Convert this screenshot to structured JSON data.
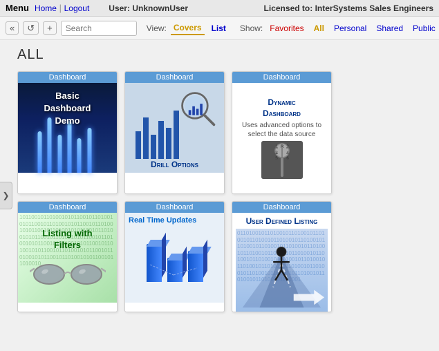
{
  "menubar": {
    "menu_label": "Menu",
    "home_link": "Home",
    "logout_link": "Logout",
    "user_prefix": "User:",
    "username": "UnknownUser",
    "licensed_prefix": "Licensed to:",
    "licensed_to": "InterSystems Sales Engineers"
  },
  "toolbar": {
    "back_label": "«",
    "refresh_label": "↺",
    "add_label": "+",
    "search_placeholder": "Search",
    "view_label": "View:",
    "covers_label": "Covers",
    "list_label": "List",
    "show_label": "Show:",
    "favorites_label": "Favorites",
    "all_label": "All",
    "personal_label": "Personal",
    "shared_label": "Shared",
    "public_label": "Public"
  },
  "main": {
    "section_title": "All",
    "cards": [
      {
        "id": "basic-dashboard",
        "header": "Dashboard",
        "title": "Basic\nDashboard\nDemo",
        "type": "basic"
      },
      {
        "id": "drill-options",
        "header": "Dashboard",
        "title": "Drill Options",
        "type": "drill"
      },
      {
        "id": "dynamic-dashboard",
        "header": "Dashboard",
        "title": "Dynamic\nDashboard",
        "subtitle": "Uses advanced options to select the data source",
        "type": "dynamic"
      },
      {
        "id": "listing-filters",
        "header": "Dashboard",
        "title": "Listing with\nFilters",
        "type": "listing"
      },
      {
        "id": "realtime-updates",
        "header": "Dashboard",
        "title": "Real Time Updates",
        "type": "realtime"
      },
      {
        "id": "user-defined",
        "header": "Dashboard",
        "title": "User Defined Listing",
        "type": "userdefined"
      }
    ]
  }
}
